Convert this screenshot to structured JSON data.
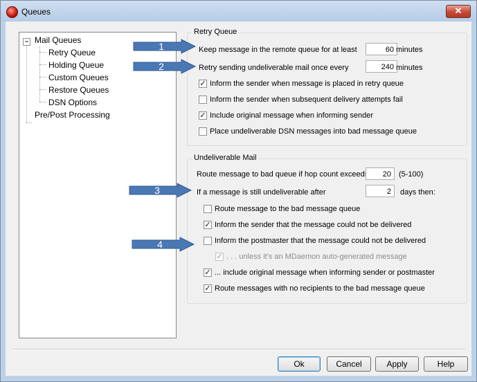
{
  "window": {
    "title": "Queues",
    "close_glyph": "✕",
    "icon": "mdaemon-app-icon"
  },
  "tree": {
    "root": "Mail Queues",
    "expander_glyph": "−",
    "children": [
      "Retry Queue",
      "Holding Queue",
      "Custom Queues",
      "Restore Queues",
      "DSN Options"
    ],
    "other": "Pre/Post Processing"
  },
  "retry_queue": {
    "title": "Retry Queue",
    "keep_label": "Keep message in the remote queue for at least",
    "keep_value": "60",
    "keep_unit": "minutes",
    "retry_label": "Retry sending undeliverable mail once every",
    "retry_value": "240",
    "retry_unit": "minutes",
    "checkboxes": [
      {
        "label": "Inform the sender when message is placed in retry queue",
        "checked": true
      },
      {
        "label": "Inform the sender when subsequent delivery attempts fail",
        "checked": false
      },
      {
        "label": "Include original message when informing sender",
        "checked": true
      },
      {
        "label": "Place undeliverable DSN messages into bad message queue",
        "checked": false
      }
    ]
  },
  "undeliverable": {
    "title": "Undeliverable Mail",
    "hop_label": "Route message to bad queue if hop count exceeds",
    "hop_value": "20",
    "hop_range": "(5-100)",
    "days_label": "If a message is still undeliverable after",
    "days_value": "2",
    "days_unit": "days then:",
    "checkboxes": [
      {
        "label": "Route message to the bad message queue",
        "checked": false,
        "enabled": true
      },
      {
        "label": "Inform the sender that the message could not be delivered",
        "checked": true,
        "enabled": true
      },
      {
        "label": "Inform the postmaster that the message could not be delivered",
        "checked": false,
        "enabled": true
      },
      {
        "label": ". . . unless it's an MDaemon auto-generated message",
        "checked": true,
        "enabled": false
      },
      {
        "label": "... include original message when informing sender or postmaster",
        "checked": true,
        "enabled": true
      },
      {
        "label": "Route messages with no recipients to the bad message queue",
        "checked": true,
        "enabled": true
      }
    ]
  },
  "callouts": [
    "1",
    "2",
    "3",
    "4"
  ],
  "check_glyph": "✓",
  "colors": {
    "arrow_fill": "#4a78b4",
    "arrow_stroke": "#2f5a92",
    "title_bar": "#bcd0e8",
    "close": "#c54a35"
  },
  "buttons": {
    "ok": "Ok",
    "cancel": "Cancel",
    "apply": "Apply",
    "help": "Help"
  }
}
